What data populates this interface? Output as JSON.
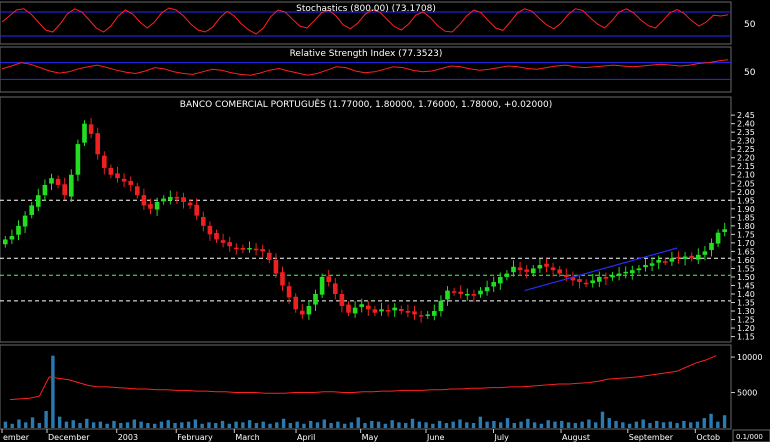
{
  "chart_data": [
    {
      "type": "line",
      "panel": "stochastics",
      "title": "Stochastics (800.00) (73.1708)",
      "yticks": [
        50
      ],
      "reference_lines": [
        80,
        20
      ],
      "colors": {
        "line": "#ff2020",
        "reference": "#2a2aff",
        "frame": "#6a6a6a"
      },
      "values": [
        55,
        70,
        85,
        88,
        75,
        55,
        35,
        30,
        50,
        75,
        88,
        80,
        60,
        40,
        30,
        45,
        70,
        85,
        75,
        55,
        40,
        55,
        78,
        90,
        85,
        70,
        50,
        35,
        30,
        42,
        65,
        82,
        70,
        50,
        35,
        25,
        40,
        68,
        85,
        80,
        62,
        45,
        40,
        58,
        78,
        85,
        70,
        48,
        38,
        52,
        74,
        86,
        80,
        62,
        44,
        35,
        50,
        72,
        80,
        66,
        46,
        32,
        30,
        48,
        70,
        85,
        78,
        58,
        40,
        34,
        55,
        78,
        88,
        82,
        64,
        48,
        38,
        52,
        74,
        88,
        84,
        66,
        50,
        40,
        58,
        80,
        88,
        78,
        60,
        46,
        40,
        58,
        78,
        86,
        76,
        58,
        45,
        55,
        72,
        70,
        73
      ]
    },
    {
      "type": "line",
      "panel": "rsi",
      "title": "Relative Strength Index (77.3523)",
      "yticks": [
        50
      ],
      "reference_lines": [
        70,
        30
      ],
      "colors": {
        "line": "#ff2020",
        "reference": "#2a2aff"
      },
      "values": [
        55,
        62,
        70,
        66,
        58,
        50,
        45,
        48,
        55,
        60,
        64,
        58,
        52,
        47,
        44,
        50,
        58,
        55,
        48,
        44,
        42,
        48,
        54,
        52,
        46,
        42,
        40,
        45,
        52,
        56,
        50,
        45,
        40,
        44,
        52,
        60,
        58,
        50,
        46,
        48,
        54,
        60,
        58,
        52,
        48,
        50,
        56,
        62,
        60,
        55,
        52,
        54,
        58,
        62,
        60,
        56,
        54,
        58,
        62,
        64,
        60,
        58,
        60,
        62,
        64,
        62,
        60,
        62,
        64,
        66,
        64,
        62,
        64,
        68,
        70,
        74,
        77
      ]
    },
    {
      "type": "candlestick",
      "panel": "price",
      "title": "BANCO COMERCIAL PORTUGUÊS (1.77000, 1.80000, 1.76000, 1.78000, +0.02000)",
      "ylim": [
        1.13,
        2.48
      ],
      "yticks": [
        1.15,
        1.2,
        1.25,
        1.3,
        1.35,
        1.4,
        1.45,
        1.5,
        1.55,
        1.6,
        1.65,
        1.7,
        1.75,
        1.8,
        1.85,
        1.9,
        1.95,
        2.0,
        2.05,
        2.1,
        2.15,
        2.2,
        2.25,
        2.3,
        2.35,
        2.4,
        2.45
      ],
      "ytick_labels": [
        "1.15",
        "1.20",
        "1.25",
        "1.30",
        "1.35",
        "1.40",
        "1.45",
        "1.50",
        "1.55",
        "1.60",
        "1.65",
        "1.70",
        "1.75",
        "1.80",
        "1.85",
        "1.90",
        "1.95",
        "2.00",
        "2.05",
        "2.10",
        "2.15",
        "2.20",
        "2.25",
        "2.30",
        "2.35",
        "2.40",
        "2.45"
      ],
      "horizontal_levels": [
        {
          "value": 1.95,
          "color": "#ffffff",
          "style": "dashed"
        },
        {
          "value": 1.61,
          "color": "#ffffff",
          "style": "dashed"
        },
        {
          "value": 1.51,
          "color": "#40ff40",
          "style": "dashed"
        },
        {
          "value": 1.36,
          "color": "#ffffff",
          "style": "dashed"
        }
      ],
      "trendline": {
        "from": [
          0.72,
          1.42
        ],
        "to": [
          0.93,
          1.67
        ],
        "color": "#2a2aff"
      },
      "colors": {
        "up": "#22dd22",
        "down": "#ee2020"
      },
      "close": [
        1.72,
        1.74,
        1.8,
        1.86,
        1.92,
        1.98,
        2.04,
        2.08,
        2.04,
        1.98,
        2.1,
        2.28,
        2.4,
        2.34,
        2.22,
        2.14,
        2.1,
        2.08,
        2.06,
        2.04,
        1.98,
        1.92,
        1.9,
        1.94,
        1.96,
        1.97,
        1.96,
        1.94,
        1.92,
        1.86,
        1.8,
        1.75,
        1.72,
        1.7,
        1.68,
        1.67,
        1.66,
        1.67,
        1.66,
        1.65,
        1.6,
        1.52,
        1.45,
        1.38,
        1.31,
        1.28,
        1.33,
        1.4,
        1.5,
        1.47,
        1.4,
        1.33,
        1.29,
        1.32,
        1.34,
        1.31,
        1.29,
        1.31,
        1.3,
        1.32,
        1.3,
        1.29,
        1.28,
        1.27,
        1.28,
        1.3,
        1.36,
        1.42,
        1.41,
        1.4,
        1.4,
        1.39,
        1.42,
        1.44,
        1.47,
        1.5,
        1.52,
        1.56,
        1.54,
        1.53,
        1.55,
        1.57,
        1.56,
        1.54,
        1.52,
        1.5,
        1.48,
        1.47,
        1.46,
        1.48,
        1.5,
        1.49,
        1.51,
        1.52,
        1.53,
        1.54,
        1.55,
        1.57,
        1.58,
        1.6,
        1.59,
        1.61,
        1.61,
        1.62,
        1.61,
        1.63,
        1.65,
        1.7,
        1.76,
        1.78
      ]
    },
    {
      "type": "bar",
      "panel": "volume",
      "yticks": [
        5000,
        10000
      ],
      "ylim": [
        0,
        11000
      ],
      "colors": {
        "bars": "#2a7ab0",
        "moving_average": "#ff2020"
      },
      "values": [
        900,
        600,
        1200,
        800,
        1500,
        700,
        2400,
        10200,
        1600,
        900,
        1100,
        700,
        1300,
        800,
        900,
        600,
        1000,
        700,
        800,
        1200,
        900,
        700,
        600,
        900,
        1100,
        700,
        800,
        900,
        1200,
        600,
        800,
        700,
        1000,
        600,
        900,
        800,
        1100,
        700,
        900,
        600,
        800,
        1300,
        700,
        900,
        600,
        1000,
        800,
        1200,
        700,
        900,
        600,
        800,
        1500,
        700,
        1000,
        900,
        600,
        1100,
        800,
        700,
        1300,
        900,
        800,
        600,
        1000,
        700,
        900,
        1200,
        800,
        700,
        1600,
        900,
        1000,
        800,
        1400,
        700,
        900,
        1300,
        800,
        600,
        1100,
        900,
        1000,
        800,
        700,
        900,
        1200,
        800,
        2300,
        1400,
        1000,
        800,
        600,
        900,
        1200,
        700,
        1000,
        800,
        900,
        700,
        1000,
        800,
        900,
        1400,
        2000,
        900,
        1800
      ],
      "moving_average": [
        4000,
        4100,
        4200,
        4500,
        7200,
        7000,
        6800,
        6400,
        6000,
        5800,
        5800,
        5700,
        5600,
        5500,
        5500,
        5400,
        5400,
        5300,
        5300,
        5200,
        5200,
        5100,
        5100,
        5000,
        5000,
        5000,
        4900,
        4900,
        4900,
        5000,
        5000,
        5000,
        5100,
        5100,
        5000,
        5000,
        5100,
        5100,
        5200,
        5200,
        5300,
        5300,
        5300,
        5400,
        5400,
        5500,
        5500,
        5600,
        5600,
        5700,
        5700,
        5800,
        5800,
        5900,
        6000,
        6100,
        6200,
        6200,
        6300,
        6400,
        6600,
        6900,
        7000,
        7100,
        7200,
        7400,
        7600,
        7800,
        8000,
        8600,
        9200,
        9600,
        10200
      ]
    }
  ],
  "x_axis": {
    "labels": [
      {
        "text": "ember",
        "pos": 0.0
      },
      {
        "text": "December",
        "pos": 0.062
      },
      {
        "text": "2003",
        "pos": 0.158
      },
      {
        "text": "February",
        "pos": 0.24
      },
      {
        "text": "March",
        "pos": 0.32
      },
      {
        "text": "April",
        "pos": 0.405
      },
      {
        "text": "May",
        "pos": 0.494
      },
      {
        "text": "June",
        "pos": 0.584
      },
      {
        "text": "July",
        "pos": 0.677
      },
      {
        "text": "August",
        "pos": 0.77
      },
      {
        "text": "September",
        "pos": 0.862
      },
      {
        "text": "Octob",
        "pos": 0.955
      }
    ]
  },
  "corner_label": "0.1/000"
}
